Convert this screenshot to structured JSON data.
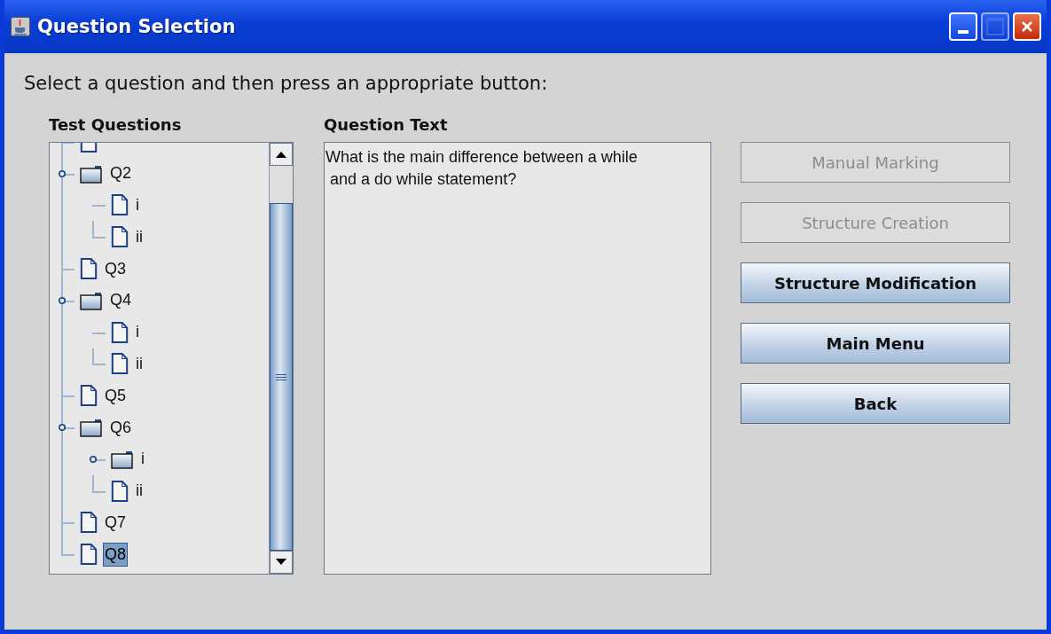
{
  "window": {
    "title": "Question Selection"
  },
  "instruction": "Select a question and then press an appropriate button:",
  "tree": {
    "heading": "Test Questions",
    "items": [
      {
        "kind": "leaf",
        "selected": false
      },
      {
        "label": "Q2",
        "kind": "folder",
        "expanded": true,
        "selected": false,
        "children": [
          {
            "label": "i",
            "kind": "leaf",
            "selected": false
          },
          {
            "label": "ii",
            "kind": "leaf",
            "selected": false
          }
        ]
      },
      {
        "label": "Q3",
        "kind": "leaf",
        "selected": false
      },
      {
        "label": "Q4",
        "kind": "folder",
        "expanded": true,
        "selected": false,
        "children": [
          {
            "label": "i",
            "kind": "leaf",
            "selected": false
          },
          {
            "label": "ii",
            "kind": "leaf",
            "selected": false
          }
        ]
      },
      {
        "label": "Q5",
        "kind": "leaf",
        "selected": false
      },
      {
        "label": "Q6",
        "kind": "folder",
        "expanded": true,
        "selected": false,
        "children": [
          {
            "label": "i",
            "kind": "folder",
            "expanded": true,
            "selected": false
          },
          {
            "label": "ii",
            "kind": "leaf",
            "selected": false
          }
        ]
      },
      {
        "label": "Q7",
        "kind": "leaf",
        "selected": false
      },
      {
        "label": "Q8",
        "kind": "leaf",
        "selected": true
      }
    ]
  },
  "question": {
    "heading": "Question Text",
    "value": "What is the main difference between a while\n and a do while statement?"
  },
  "buttons": [
    {
      "label": "Manual Marking",
      "disabled": true
    },
    {
      "label": "Structure Creation",
      "disabled": true
    },
    {
      "label": "Structure Modification",
      "disabled": false
    },
    {
      "label": "Main Menu",
      "disabled": false
    },
    {
      "label": "Back",
      "disabled": false
    }
  ]
}
